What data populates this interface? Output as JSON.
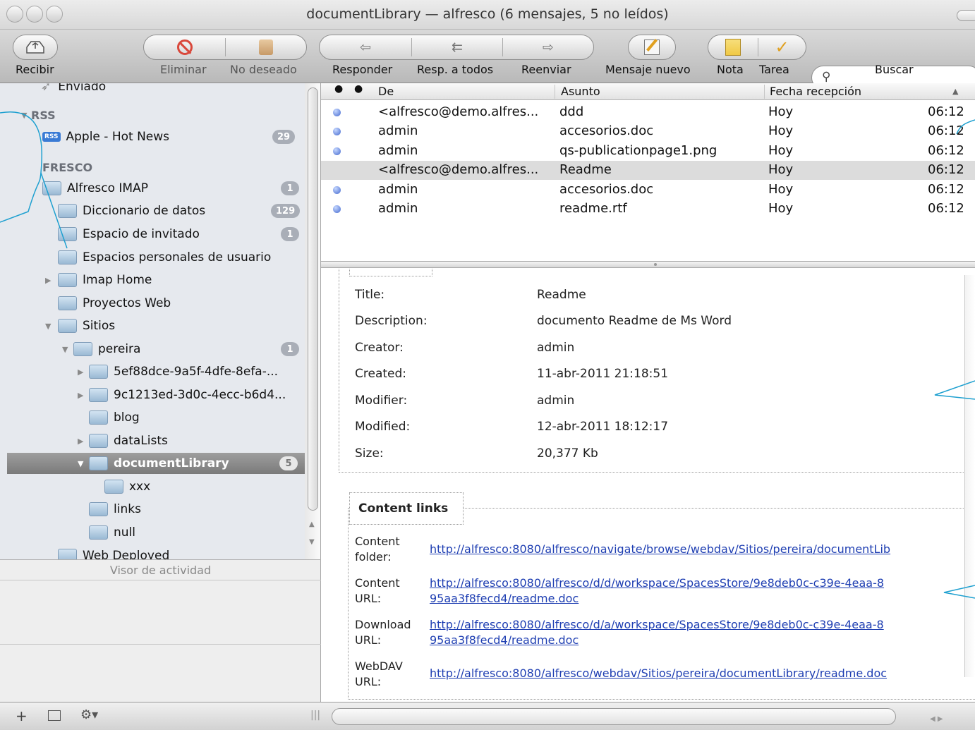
{
  "window": {
    "title": "documentLibrary — alfresco (6 mensajes, 5 no leídos)"
  },
  "toolbar": {
    "get_mail": "Recibir",
    "delete": "Eliminar",
    "junk": "No deseado",
    "reply": "Responder",
    "reply_all": "Resp. a todos",
    "forward": "Reenviar",
    "new_message": "Mensaje nuevo",
    "note": "Nota",
    "todo": "Tarea",
    "search": "Buscar"
  },
  "sidebar": {
    "sent": "Enviado",
    "rss_header": "RSS",
    "rss_feed": {
      "label": "Apple - Hot News",
      "badge": "29"
    },
    "alfresco_header": "FRESCO",
    "folders": [
      {
        "label": "Alfresco IMAP",
        "badge": "1"
      },
      {
        "label": "Diccionario de datos",
        "badge": "129"
      },
      {
        "label": "Espacio de invitado",
        "badge": "1"
      },
      {
        "label": "Espacios personales de usuario"
      },
      {
        "label": "Imap Home"
      },
      {
        "label": "Proyectos Web"
      },
      {
        "label": "Sitios"
      },
      {
        "label": "pereira",
        "badge": "1"
      },
      {
        "label": "5ef88dce-9a5f-4dfe-8efa-..."
      },
      {
        "label": "9c1213ed-3d0c-4ecc-b6d4..."
      },
      {
        "label": "blog"
      },
      {
        "label": "dataLists"
      },
      {
        "label": "documentLibrary",
        "badge": "5"
      },
      {
        "label": "xxx"
      },
      {
        "label": "links"
      },
      {
        "label": "null"
      },
      {
        "label": "Web Deployed"
      }
    ],
    "rss_icon": "RSS"
  },
  "activity": {
    "title": "Visor de actividad"
  },
  "message_list": {
    "columns": [
      "De",
      "Asunto",
      "Fecha recepción"
    ],
    "rows": [
      {
        "from": "<alfresco@demo.alfres...",
        "subject": "ddd",
        "date": "Hoy",
        "time": "06:12",
        "unread": true
      },
      {
        "from": "admin",
        "subject": "accesorios.doc",
        "date": "Hoy",
        "time": "06:12",
        "unread": true
      },
      {
        "from": "admin",
        "subject": "qs-publicationpage1.png",
        "date": "Hoy",
        "time": "06:12",
        "unread": true
      },
      {
        "from": "<alfresco@demo.alfres...",
        "subject": "Readme",
        "date": "Hoy",
        "time": "06:12",
        "unread": false
      },
      {
        "from": "admin",
        "subject": "accesorios.doc",
        "date": "Hoy",
        "time": "06:12",
        "unread": true
      },
      {
        "from": "admin",
        "subject": "readme.rtf",
        "date": "Hoy",
        "time": "06:12",
        "unread": true
      }
    ]
  },
  "preview": {
    "properties": [
      {
        "label": "Title:",
        "value": "Readme"
      },
      {
        "label": "Description:",
        "value": "documento Readme de Ms Word"
      },
      {
        "label": "Creator:",
        "value": "admin"
      },
      {
        "label": "Created:",
        "value": "11-abr-2011 21:18:51"
      },
      {
        "label": "Modifier:",
        "value": "admin"
      },
      {
        "label": "Modified:",
        "value": "12-abr-2011 18:12:17"
      },
      {
        "label": "Size:",
        "value": "20,377 Kb"
      }
    ],
    "links_title": "Content links",
    "links": [
      {
        "l1": "Content",
        "l2": "folder:",
        "u1": "http://alfresco:8080/alfresco/navigate/browse/webdav/Sitios/pereira/documentLib",
        "u2": ""
      },
      {
        "l1": "Content",
        "l2": "URL:",
        "u1": "http://alfresco:8080/alfresco/d/d/workspace/SpacesStore/9e8deb0c-c39e-4eaa-8",
        "u2": "95aa3f8fecd4/readme.doc"
      },
      {
        "l1": "Download",
        "l2": "URL:",
        "u1": "http://alfresco:8080/alfresco/d/a/workspace/SpacesStore/9e8deb0c-c39e-4eaa-8",
        "u2": "95aa3f8fecd4/readme.doc"
      },
      {
        "l1": "WebDAV",
        "l2": "URL:",
        "u1": "http://alfresco:8080/alfresco/webdav/Sitios/pereira/documentLibrary/readme.doc",
        "u2": ""
      }
    ]
  },
  "colors": {
    "unread_dot": "#4469cf",
    "link": "#1e3eb2",
    "callout": "#1ea0d0",
    "selection": "#8c8c8c"
  }
}
